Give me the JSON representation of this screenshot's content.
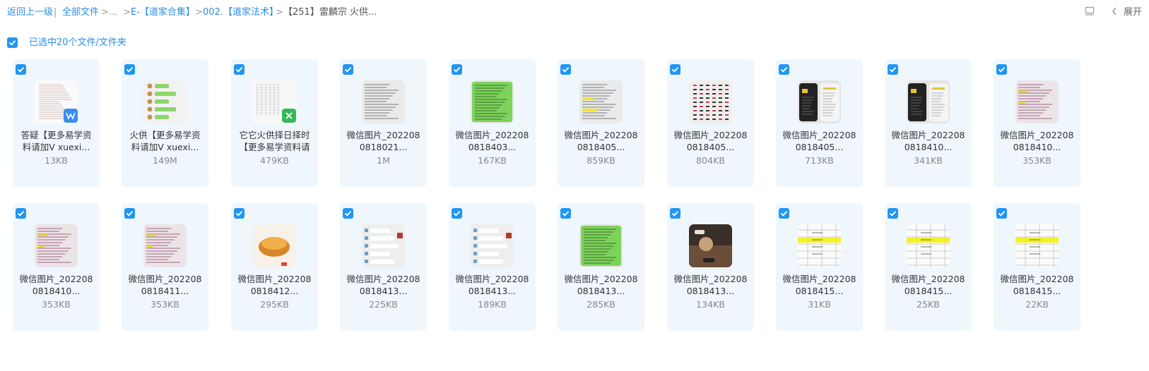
{
  "breadcrumb": {
    "back": "返回上一级",
    "separator": "|",
    "all_files": "全部文件",
    "arrow": ">",
    "ellipsis": "...",
    "folder1": "E-【道家合集】",
    "folder2": "002.【道家法术】",
    "current": "【251】雷麟宗 火供..."
  },
  "toolbar": {
    "expand_label": "展开",
    "view_icon": "list-view-icon",
    "chevron_icon": "chevron-left-icon"
  },
  "selection": {
    "label": "已选中20个文件/文件夹",
    "checked": true
  },
  "colors": {
    "accent": "#2196f3",
    "card_bg": "#eff7fd",
    "link": "#2a8ee8"
  },
  "files": [
    {
      "line1": "答疑【更多易学资",
      "line2": "料请加V xuexi...",
      "size": "13KB",
      "type": "word-doc",
      "checked": true
    },
    {
      "line1": "火供【更多易学资",
      "line2": "料请加V xuexi...",
      "size": "149M",
      "type": "chat-image",
      "checked": true
    },
    {
      "line1": "它它火供择日择时",
      "line2": "【更多易学资料请",
      "size": "479KB",
      "type": "excel-sheet",
      "checked": true
    },
    {
      "line1": "微信图片_202208",
      "line2": "0818021...",
      "size": "1M",
      "type": "image-text",
      "checked": true
    },
    {
      "line1": "微信图片_202208",
      "line2": "0818403...",
      "size": "167KB",
      "type": "image-green-text",
      "checked": true
    },
    {
      "line1": "微信图片_202208",
      "line2": "0818405...",
      "size": "859KB",
      "type": "image-text-yellow",
      "checked": true
    },
    {
      "line1": "微信图片_202208",
      "line2": "0818405...",
      "size": "804KB",
      "type": "image-table",
      "checked": true
    },
    {
      "line1": "微信图片_202208",
      "line2": "0818405...",
      "size": "713KB",
      "type": "image-phone-dark",
      "checked": true
    },
    {
      "line1": "微信图片_202208",
      "line2": "0818410...",
      "size": "341KB",
      "type": "image-phone-dark",
      "checked": true
    },
    {
      "line1": "微信图片_202208",
      "line2": "0818410...",
      "size": "353KB",
      "type": "image-text-pink",
      "checked": true
    },
    {
      "line1": "微信图片_202208",
      "line2": "0818410...",
      "size": "353KB",
      "type": "image-text-pink",
      "checked": true
    },
    {
      "line1": "微信图片_202208",
      "line2": "0818411...",
      "size": "353KB",
      "type": "image-text-pink",
      "checked": true
    },
    {
      "line1": "微信图片_202208",
      "line2": "0818412...",
      "size": "295KB",
      "type": "image-food",
      "checked": true
    },
    {
      "line1": "微信图片_202208",
      "line2": "0818413...",
      "size": "225KB",
      "type": "image-chat",
      "checked": true
    },
    {
      "line1": "微信图片_202208",
      "line2": "0818413...",
      "size": "189KB",
      "type": "image-chat",
      "checked": true
    },
    {
      "line1": "微信图片_202208",
      "line2": "0818413...",
      "size": "285KB",
      "type": "image-green-text",
      "checked": true
    },
    {
      "line1": "微信图片_202208",
      "line2": "0818413...",
      "size": "134KB",
      "type": "image-photo",
      "checked": true
    },
    {
      "line1": "微信图片_202208",
      "line2": "0818415...",
      "size": "31KB",
      "type": "image-sheet-yellow",
      "checked": true
    },
    {
      "line1": "微信图片_202208",
      "line2": "0818415...",
      "size": "25KB",
      "type": "image-sheet-yellow",
      "checked": true
    },
    {
      "line1": "微信图片_202208",
      "line2": "0818415...",
      "size": "22KB",
      "type": "image-sheet-yellow",
      "checked": true
    }
  ]
}
